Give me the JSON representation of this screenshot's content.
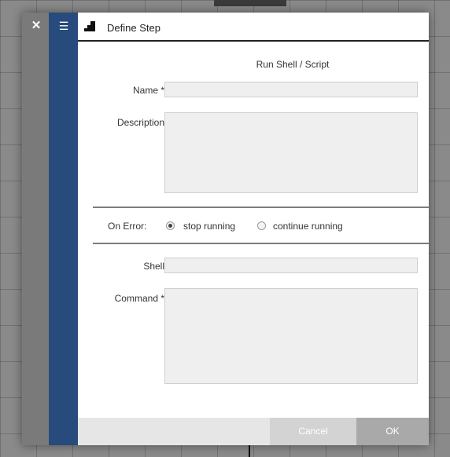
{
  "dialog": {
    "title": "Define Step",
    "section_title": "Run Shell / Script",
    "icons": {
      "close": "close-icon",
      "menu": "hamburger-menu-icon",
      "step": "steps-icon"
    }
  },
  "form": {
    "name_label": "Name *",
    "name_value": "",
    "description_label": "Description",
    "description_value": "",
    "on_error_label": "On Error:",
    "on_error_options": [
      "stop running",
      "continue running"
    ],
    "on_error_selected": "stop running",
    "shell_label": "Shell",
    "shell_value": "",
    "command_label": "Command *",
    "command_value": ""
  },
  "footer": {
    "cancel_label": "Cancel",
    "ok_label": "OK"
  },
  "colors": {
    "menu_bar": "#264b7c",
    "close_bar": "#7a7a7a",
    "field_bg": "#efefef"
  }
}
